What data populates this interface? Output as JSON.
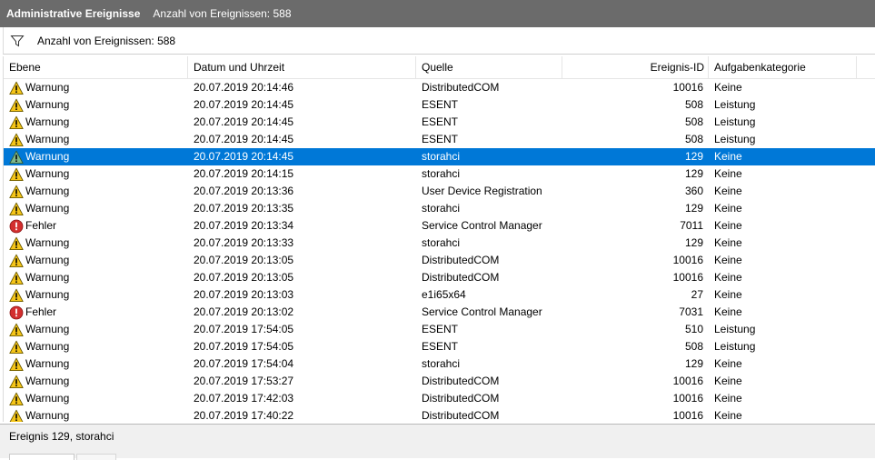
{
  "title": {
    "section": "Administrative Ereignisse",
    "count": "Anzahl von Ereignissen: 588"
  },
  "filter": {
    "icon": "filter-icon",
    "text": "Anzahl von Ereignissen: 588"
  },
  "columns": {
    "level": "Ebene",
    "date": "Datum und Uhrzeit",
    "source": "Quelle",
    "event_id": "Ereignis-ID",
    "category": "Aufgabenkategorie"
  },
  "rows": [
    {
      "level": "Warnung",
      "date": "20.07.2019 20:14:46",
      "source": "DistributedCOM",
      "event_id": "10016",
      "category": "Keine"
    },
    {
      "level": "Warnung",
      "date": "20.07.2019 20:14:45",
      "source": "ESENT",
      "event_id": "508",
      "category": "Leistung"
    },
    {
      "level": "Warnung",
      "date": "20.07.2019 20:14:45",
      "source": "ESENT",
      "event_id": "508",
      "category": "Leistung"
    },
    {
      "level": "Warnung",
      "date": "20.07.2019 20:14:45",
      "source": "ESENT",
      "event_id": "508",
      "category": "Leistung"
    },
    {
      "level": "Warnung",
      "date": "20.07.2019 20:14:45",
      "source": "storahci",
      "event_id": "129",
      "category": "Keine",
      "selected": true
    },
    {
      "level": "Warnung",
      "date": "20.07.2019 20:14:15",
      "source": "storahci",
      "event_id": "129",
      "category": "Keine"
    },
    {
      "level": "Warnung",
      "date": "20.07.2019 20:13:36",
      "source": "User Device Registration",
      "event_id": "360",
      "category": "Keine"
    },
    {
      "level": "Warnung",
      "date": "20.07.2019 20:13:35",
      "source": "storahci",
      "event_id": "129",
      "category": "Keine"
    },
    {
      "level": "Fehler",
      "date": "20.07.2019 20:13:34",
      "source": "Service Control Manager",
      "event_id": "7011",
      "category": "Keine"
    },
    {
      "level": "Warnung",
      "date": "20.07.2019 20:13:33",
      "source": "storahci",
      "event_id": "129",
      "category": "Keine"
    },
    {
      "level": "Warnung",
      "date": "20.07.2019 20:13:05",
      "source": "DistributedCOM",
      "event_id": "10016",
      "category": "Keine"
    },
    {
      "level": "Warnung",
      "date": "20.07.2019 20:13:05",
      "source": "DistributedCOM",
      "event_id": "10016",
      "category": "Keine"
    },
    {
      "level": "Warnung",
      "date": "20.07.2019 20:13:03",
      "source": "e1i65x64",
      "event_id": "27",
      "category": "Keine"
    },
    {
      "level": "Fehler",
      "date": "20.07.2019 20:13:02",
      "source": "Service Control Manager",
      "event_id": "7031",
      "category": "Keine"
    },
    {
      "level": "Warnung",
      "date": "20.07.2019 17:54:05",
      "source": "ESENT",
      "event_id": "510",
      "category": "Leistung"
    },
    {
      "level": "Warnung",
      "date": "20.07.2019 17:54:05",
      "source": "ESENT",
      "event_id": "508",
      "category": "Leistung"
    },
    {
      "level": "Warnung",
      "date": "20.07.2019 17:54:04",
      "source": "storahci",
      "event_id": "129",
      "category": "Keine"
    },
    {
      "level": "Warnung",
      "date": "20.07.2019 17:53:27",
      "source": "DistributedCOM",
      "event_id": "10016",
      "category": "Keine"
    },
    {
      "level": "Warnung",
      "date": "20.07.2019 17:42:03",
      "source": "DistributedCOM",
      "event_id": "10016",
      "category": "Keine"
    },
    {
      "level": "Warnung",
      "date": "20.07.2019 17:40:22",
      "source": "DistributedCOM",
      "event_id": "10016",
      "category": "Keine"
    }
  ],
  "status": {
    "text": "Ereignis 129, storahci"
  },
  "colors": {
    "selection": "#0078d7",
    "titlebar": "#6b6b6b",
    "warning": "#f5c518",
    "error": "#d32f2f"
  }
}
